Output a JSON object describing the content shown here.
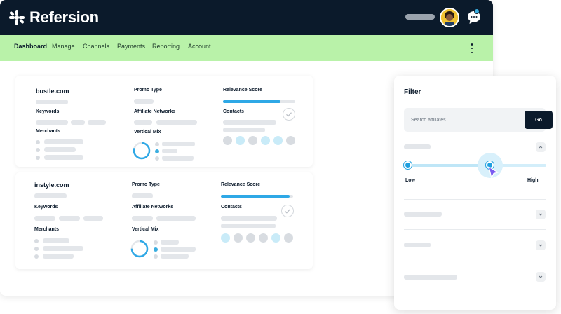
{
  "app": {
    "brand": "Refersion",
    "nav": [
      {
        "label": "Dashboard",
        "active": true
      },
      {
        "label": "Manage",
        "active": false
      },
      {
        "label": "Channels",
        "active": false
      },
      {
        "label": "Payments",
        "active": false
      },
      {
        "label": "Reporting",
        "active": false
      },
      {
        "label": "Account",
        "active": false
      }
    ],
    "nav_color": "#b9f2a9",
    "topbar_color": "#0b1a2b",
    "accent_color": "#2ea8e6"
  },
  "affiliates": [
    {
      "site": "bustle.com",
      "keywords_label": "Keywords",
      "merchants_label": "Merchants",
      "promo_type_label": "Promo Type",
      "affiliate_networks_label": "Affiliate Networks",
      "vertical_mix_label": "Vertical Mix",
      "relevance_score_label": "Relevance Score",
      "contacts_label": "Contacts",
      "relevance_score": 0.8,
      "vertical_mix_fraction": 0.8
    },
    {
      "site": "instyle.com",
      "keywords_label": "Keywords",
      "merchants_label": "Merchants",
      "promo_type_label": "Promo Type",
      "affiliate_networks_label": "Affiliate Networks",
      "vertical_mix_label": "Vertical Mix",
      "relevance_score_label": "Relevance Score",
      "contacts_label": "Contacts",
      "relevance_score": 0.95,
      "vertical_mix_fraction": 0.75
    }
  ],
  "filter": {
    "title": "Filter",
    "search_placeholder": "Search affiliates",
    "go_label": "Go",
    "slider": {
      "low_label": "Low",
      "high_label": "High",
      "value_fraction": 0.6
    }
  },
  "icons": [
    "logo-asterisk-icon",
    "avatar",
    "chat-bubble-icon",
    "kebab-menu-icon",
    "check-icon",
    "chevron-up-icon",
    "chevron-down-icon",
    "cursor-pointer-icon"
  ]
}
